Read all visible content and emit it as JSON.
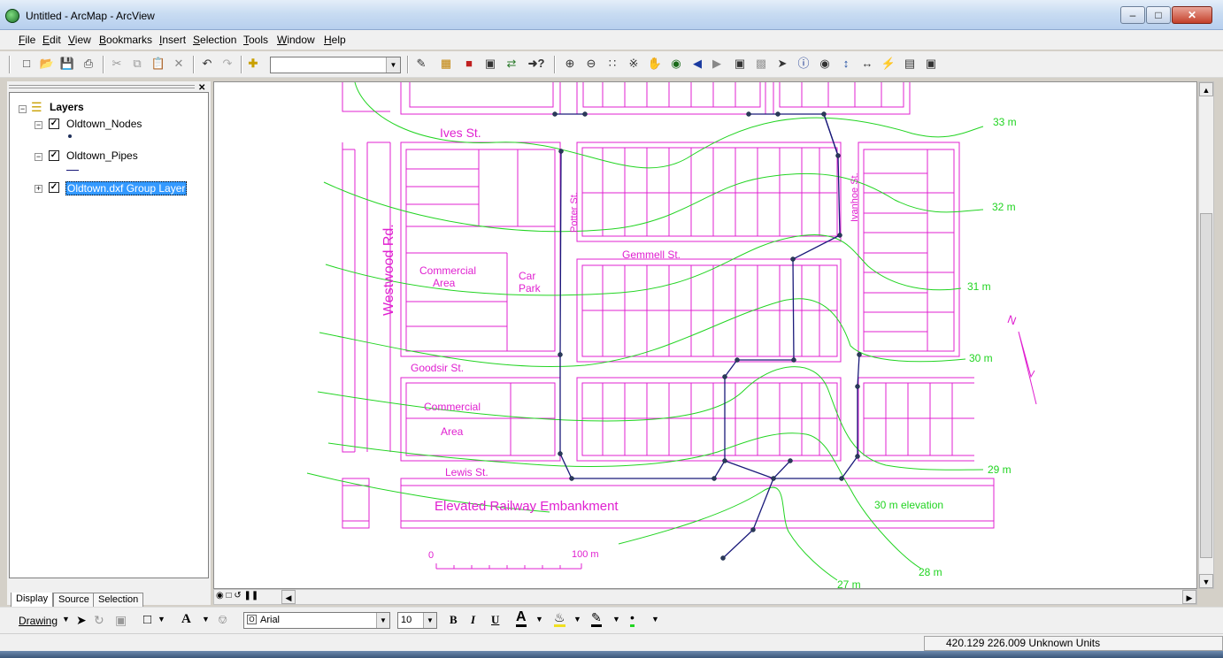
{
  "window": {
    "title": "Untitled - ArcMap - ArcView",
    "minimize": "–",
    "maximize": "□",
    "close": "✕"
  },
  "menu": [
    {
      "label": "File"
    },
    {
      "label": "Edit"
    },
    {
      "label": "View"
    },
    {
      "label": "Bookmarks"
    },
    {
      "label": "Insert"
    },
    {
      "label": "Selection"
    },
    {
      "label": "Tools"
    },
    {
      "label": "Window"
    },
    {
      "label": "Help"
    }
  ],
  "toolbar": {
    "icons": [
      "new-document-icon",
      "open-folder-icon",
      "save-icon",
      "print-icon",
      "cut-icon",
      "copy-icon",
      "paste-icon",
      "delete-icon",
      "undo-icon",
      "redo-icon",
      "add-data-icon"
    ],
    "scale_value": "",
    "tools": [
      "editor-toolbar-icon",
      "arctoolbox-icon",
      "arccatalog-icon",
      "command-line-icon",
      "model-builder-icon",
      "whats-this-icon",
      "zoom-in-icon",
      "zoom-out-icon",
      "fixed-zoom-in-icon",
      "fixed-zoom-out-icon",
      "pan-icon",
      "full-extent-icon",
      "back-extent-icon",
      "forward-extent-icon",
      "select-features-icon",
      "clear-selection-icon",
      "select-elements-icon",
      "identify-icon",
      "find-icon",
      "go-to-xy-icon",
      "measure-icon",
      "hyperlink-icon",
      "html-popup-icon",
      "create-viewer-icon"
    ]
  },
  "toc": {
    "root_label": "Layers",
    "layers": [
      {
        "label": "Oldtown_Nodes",
        "checked": true
      },
      {
        "label": "Oldtown_Pipes",
        "checked": true
      },
      {
        "label": "Oldtown.dxf Group Layer",
        "checked": true,
        "selected": true
      }
    ],
    "tabs": [
      {
        "label": "Display"
      },
      {
        "label": "Source"
      },
      {
        "label": "Selection"
      }
    ]
  },
  "map": {
    "street_labels": {
      "ives": "Ives  St.",
      "westwood": "Westwood   Rd.",
      "potter": "Potter  St.",
      "ivanhoe": "Ivanhoe  St.",
      "gemmell": "Gemmell  St.",
      "goodsir": "Goodsir  St.",
      "lewis": "Lewis  St."
    },
    "area_labels": {
      "commercial_1a": "Commercial",
      "commercial_1b": "Area",
      "car_1": "Car",
      "car_2": "Park",
      "commercial_2a": "Commercial",
      "commercial_2b": "Area",
      "railway": "Elevated Railway Embankment",
      "elevation_note": "30 m elevation"
    },
    "contour_labels": [
      "33 m",
      "32 m",
      "31 m",
      "30 m",
      "29 m",
      "28 m",
      "27 m"
    ],
    "scalebar": {
      "start": "0",
      "end": "100 m"
    },
    "north_label": "N",
    "colors": {
      "parcels": "#e020d0",
      "contours": "#22d422",
      "pipes": "#1a1a7a",
      "nodes": "#2a3a5a"
    }
  },
  "drawing_toolbar": {
    "drawing_label": "Drawing",
    "font_name": "Arial",
    "font_size": "10",
    "bold": "B",
    "italic": "I",
    "underline": "U"
  },
  "status": {
    "coordinates": "420.129  226.009 Unknown Units"
  }
}
